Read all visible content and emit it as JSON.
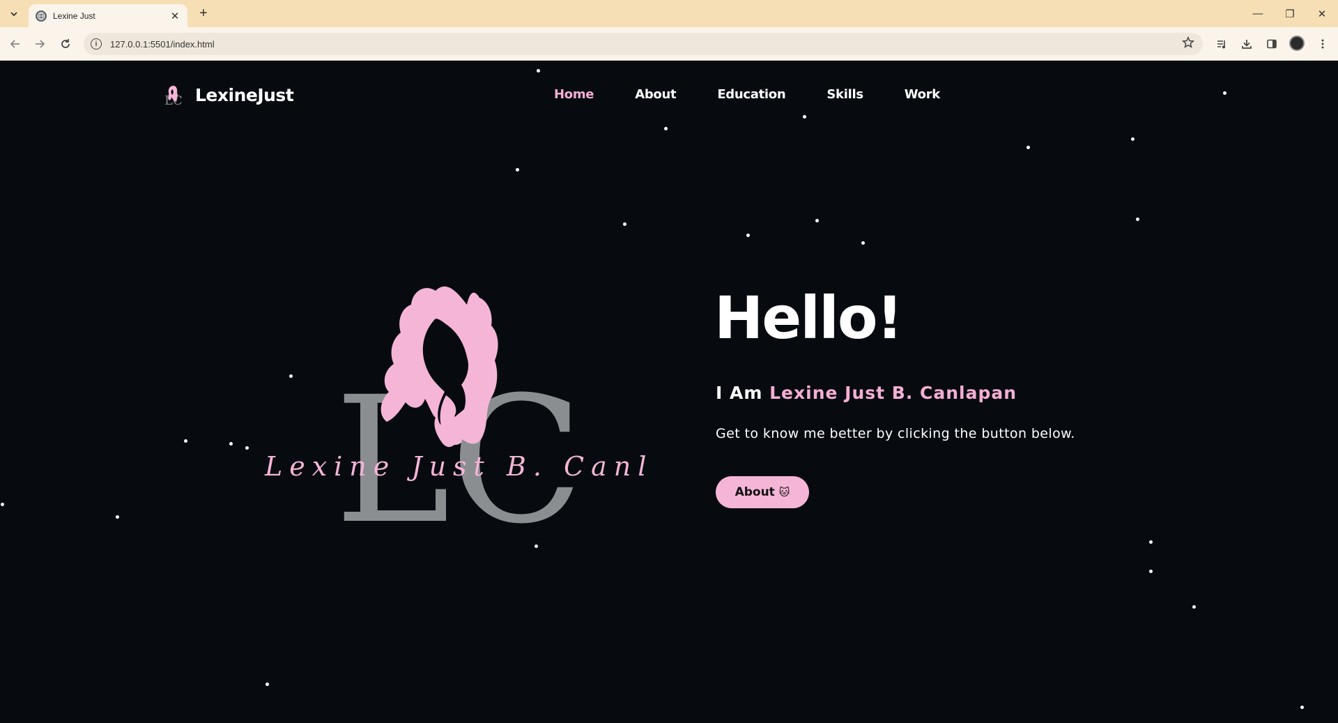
{
  "browser": {
    "tab_title": "Lexine Just",
    "url": "127.0.0.1:5501/index.html",
    "new_tab_symbol": "+",
    "close_tab_symbol": "✕",
    "window_controls": {
      "minimize": "—",
      "restore": "❐",
      "close": "✕"
    }
  },
  "site": {
    "brand": "LexineJust",
    "nav": [
      {
        "label": "Home",
        "active": true
      },
      {
        "label": "About",
        "active": false
      },
      {
        "label": "Education",
        "active": false
      },
      {
        "label": "Skills",
        "active": false
      },
      {
        "label": "Work",
        "active": false
      }
    ],
    "hero": {
      "greeting": "Hello!",
      "intro_prefix": "I Am ",
      "name": "Lexine Just B. Canlapan",
      "tagline": "Get to know me better by clicking the button below.",
      "button_label": "About",
      "button_icon": "🐱"
    },
    "logo_art": {
      "monogram": "LC",
      "signature": "Lexine Just B. Canlapan"
    }
  },
  "colors": {
    "accent_pink": "#f5aed3",
    "button_pink": "#f5b5d6",
    "page_bg": "#070b10",
    "chrome_tab": "#f6dfb5"
  },
  "icons": {
    "back": "arrow-left-icon",
    "forward": "arrow-right-icon",
    "reload": "reload-icon",
    "site_info": "info-icon",
    "bookmark": "star-icon",
    "media": "media-control-icon",
    "download": "download-icon",
    "sidepanel": "side-panel-icon",
    "menu": "kebab-menu-icon"
  }
}
